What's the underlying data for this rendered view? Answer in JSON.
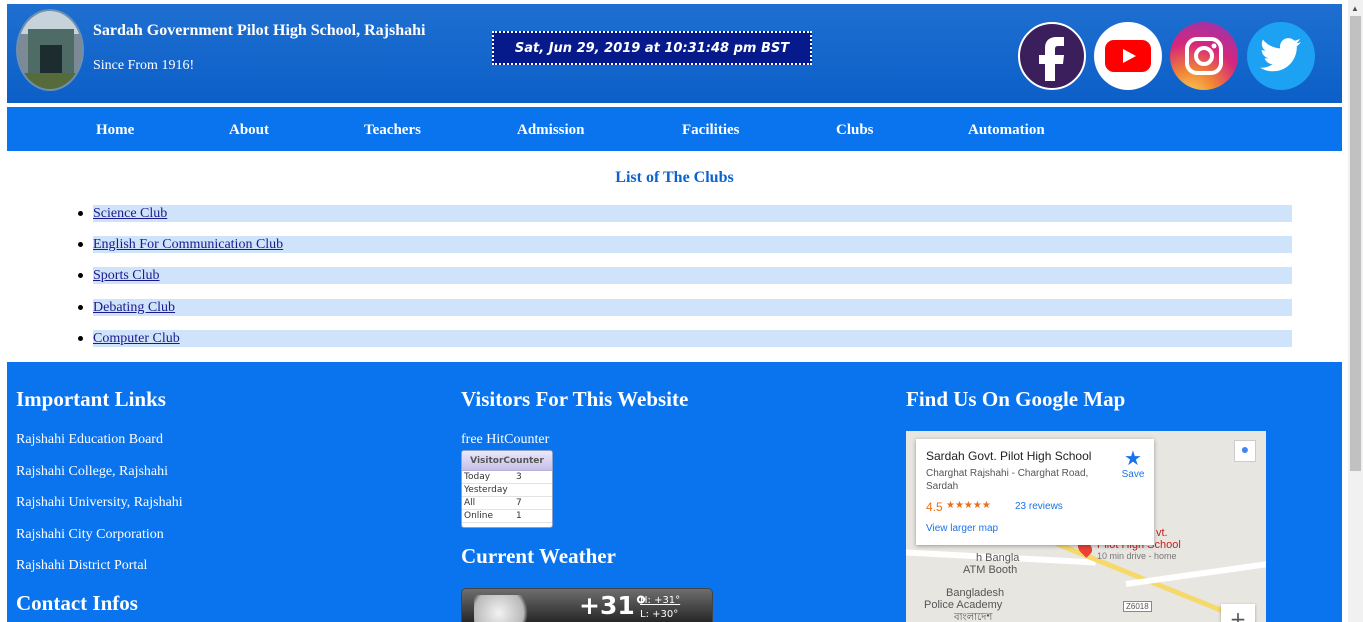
{
  "header": {
    "school_name": "Sardah Government Pilot High School, Rajshahi",
    "since": "Since From 1916!",
    "clock": "Sat, Jun 29, 2019 at 10:31:48 pm BST",
    "social": [
      "facebook-icon",
      "youtube-icon",
      "instagram-icon",
      "twitter-icon"
    ]
  },
  "nav": {
    "items": [
      "Home",
      "About",
      "Teachers",
      "Admission",
      "Facilities",
      "Clubs",
      "Automation"
    ]
  },
  "main": {
    "title": "List of The Clubs",
    "clubs": [
      "Science Club",
      "English For Communication Club",
      "Sports Club",
      "Debating Club",
      "Computer Club"
    ]
  },
  "footer": {
    "links_heading": "Important Links",
    "links": [
      "Rajshahi Education Board",
      "Rajshahi College, Rajshahi",
      "Rajshahi University, Rajshahi",
      "Rajshahi City Corporation",
      "Rajshahi District Portal"
    ],
    "contact_heading": "Contact Infos",
    "visitors_heading": "Visitors For This Website",
    "hitcounter_text": "free HitCounter",
    "counter": {
      "title": "VisitorCounter",
      "rows": [
        {
          "label": "Today",
          "value": "3"
        },
        {
          "label": "Yesterday",
          "value": ""
        },
        {
          "label": "All",
          "value": "7"
        },
        {
          "label": "Online",
          "value": "1"
        }
      ]
    },
    "weather_heading": "Current Weather",
    "weather": {
      "temp": "+31°",
      "unit": "C",
      "high": "H: +31°",
      "low": "L: +30°"
    },
    "map_heading": "Find Us On Google Map",
    "map": {
      "place_name": "Sardah Govt. Pilot High School",
      "address": "Charghat Rajshahi - Charghat Road, Sardah",
      "rating": "4.5",
      "stars": "★★★★★",
      "reviews": "23 reviews",
      "save": "Save",
      "larger_map": "View larger map",
      "labels": [
        "vt.",
        "Pilot High School",
        "10 min drive - home",
        "h Bangla",
        "ATM Booth",
        "Bangladesh",
        "Police Academy",
        "বাংলাদেশ",
        "Z6018"
      ]
    }
  },
  "colors": {
    "header_blue": "#0b5fc7",
    "nav_blue": "#0a73ee",
    "club_highlight": "#cfe3fb",
    "clock_bg": "#061a8c"
  }
}
